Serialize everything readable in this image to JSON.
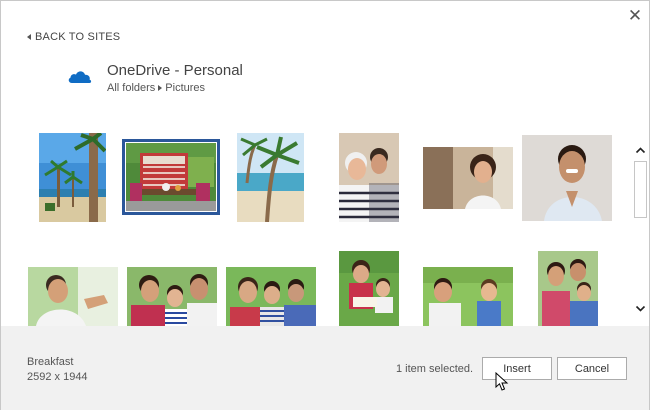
{
  "dialog": {
    "close_glyph": "✕",
    "back_label": "BACK TO SITES"
  },
  "location": {
    "service_name": "OneDrive - Personal",
    "service_icon": "onedrive-cloud-icon",
    "brand_color": "#0f6cc4",
    "breadcrumb": [
      "All folders",
      "Pictures"
    ]
  },
  "photos": [
    {
      "name": "palm-trees-beach",
      "selected": false
    },
    {
      "name": "breakfast",
      "selected": true
    },
    {
      "name": "palm-tree-shore",
      "selected": false
    },
    {
      "name": "grandparents-couple",
      "selected": false
    },
    {
      "name": "smiling-woman",
      "selected": false
    },
    {
      "name": "smiling-man",
      "selected": false
    },
    {
      "name": "man-outdoors",
      "selected": false
    },
    {
      "name": "family-of-four",
      "selected": false
    },
    {
      "name": "family-on-grass",
      "selected": false
    },
    {
      "name": "mother-reading-child",
      "selected": false
    },
    {
      "name": "mother-son-lawn",
      "selected": false
    },
    {
      "name": "father-children",
      "selected": false
    }
  ],
  "selection": {
    "file_name": "Breakfast",
    "dimensions": "2592 x 1944",
    "status": "1 item selected."
  },
  "buttons": {
    "insert": "Insert",
    "cancel": "Cancel"
  },
  "accent_color": "#2b579a"
}
